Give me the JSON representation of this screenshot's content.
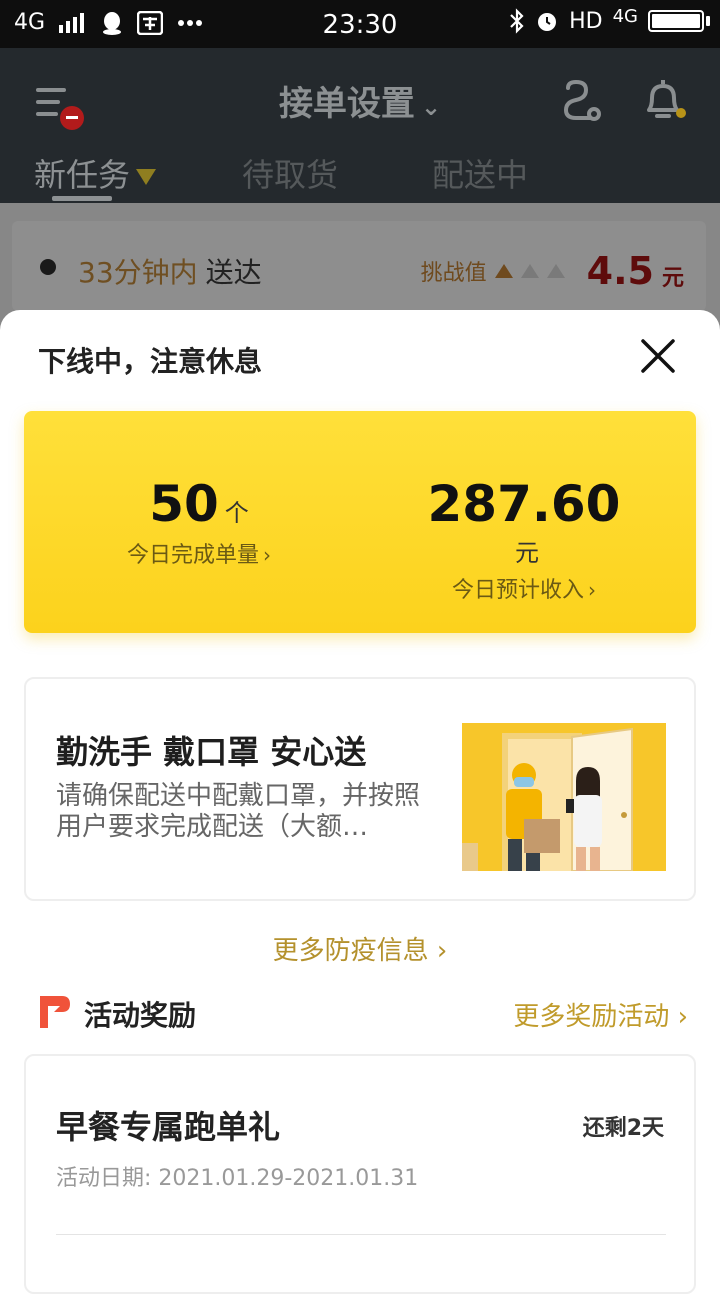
{
  "status_bar": {
    "network": "4G",
    "time": "23:30",
    "hd": "HD",
    "network_right": "4G"
  },
  "header": {
    "title": "接单设置",
    "tabs": [
      {
        "label": "新任务"
      },
      {
        "label": "待取货"
      },
      {
        "label": "配送中"
      }
    ]
  },
  "task_preview": {
    "time_highlight": "33分钟内",
    "time_suffix": "送达",
    "challenge_label": "挑战值",
    "challenge_value": "4.5",
    "challenge_unit": "元"
  },
  "sheet": {
    "title": "下线中，注意休息",
    "stats": [
      {
        "value": "50",
        "unit": "个",
        "label": "今日完成单量"
      },
      {
        "value": "287.60",
        "unit": "元",
        "label": "今日预计收入"
      }
    ],
    "notice": {
      "title": "勤洗手 戴口罩 安心送",
      "body": "请确保配送中配戴口罩，并按照用户要求完成配送（大额…"
    },
    "more_epidemic": "更多防疫信息",
    "activities_section": {
      "title": "活动奖励",
      "more_label": "更多奖励活动"
    },
    "activity": {
      "name": "早餐专属跑单礼",
      "remaining": "还剩2天",
      "date": "活动日期: 2021.01.29-2021.01.31"
    }
  },
  "colors": {
    "accent_yellow": "#fcd21c",
    "gold_text": "#b4912d",
    "flag_red": "#f0533a"
  }
}
